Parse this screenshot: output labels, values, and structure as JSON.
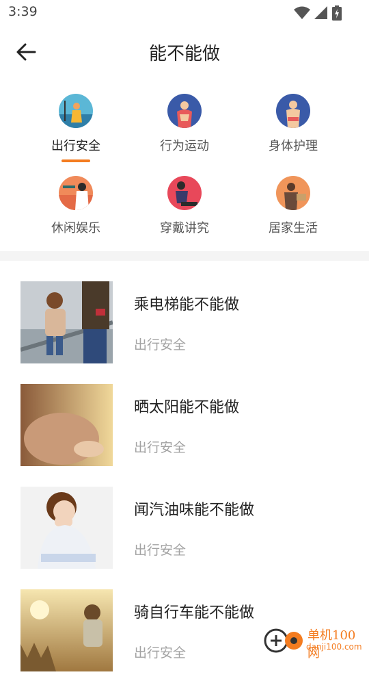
{
  "status": {
    "time": "3:39"
  },
  "header": {
    "title": "能不能做"
  },
  "categories": [
    {
      "label": "出行安全"
    },
    {
      "label": "行为运动"
    },
    {
      "label": "身体护理"
    },
    {
      "label": "休闲娱乐"
    },
    {
      "label": "穿戴讲究"
    },
    {
      "label": "居家生活"
    }
  ],
  "articles": [
    {
      "title": "乘电梯能不能做",
      "category": "出行安全"
    },
    {
      "title": "晒太阳能不能做",
      "category": "出行安全"
    },
    {
      "title": "闻汽油味能不能做",
      "category": "出行安全"
    },
    {
      "title": "骑自行车能不能做",
      "category": "出行安全"
    }
  ],
  "watermark": {
    "name": "单机100网",
    "url": "danji100.com"
  }
}
